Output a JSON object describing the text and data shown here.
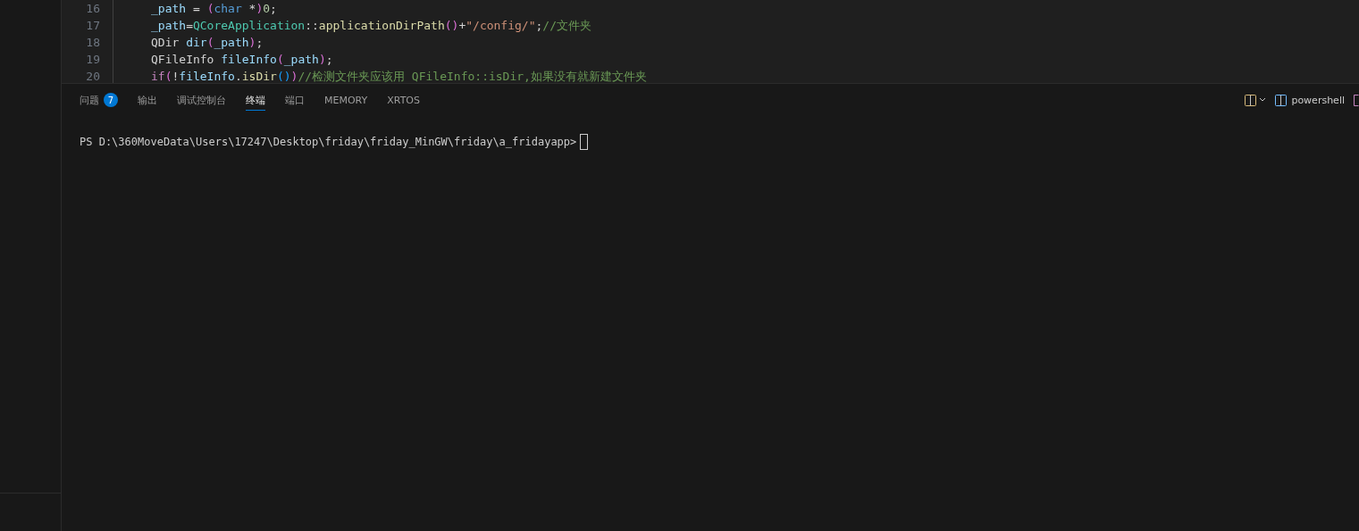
{
  "editor": {
    "lines": [
      {
        "number": "16",
        "tokens": [
          {
            "kind": "var",
            "text": "_path"
          },
          {
            "kind": "op",
            "text": " = "
          },
          {
            "kind": "paren",
            "text": "("
          },
          {
            "kind": "keyword",
            "text": "char"
          },
          {
            "kind": "op",
            "text": " *"
          },
          {
            "kind": "paren",
            "text": ")"
          },
          {
            "kind": "num",
            "text": "0"
          },
          {
            "kind": "op",
            "text": ";"
          }
        ]
      },
      {
        "number": "17",
        "tokens": [
          {
            "kind": "var",
            "text": "_path"
          },
          {
            "kind": "op",
            "text": "="
          },
          {
            "kind": "type",
            "text": "QCoreApplication"
          },
          {
            "kind": "op",
            "text": "::"
          },
          {
            "kind": "func",
            "text": "applicationDirPath"
          },
          {
            "kind": "paren",
            "text": "()"
          },
          {
            "kind": "op",
            "text": "+"
          },
          {
            "kind": "str",
            "text": "\"/config/\""
          },
          {
            "kind": "op",
            "text": ";"
          },
          {
            "kind": "comment",
            "text": "//文件夹"
          }
        ]
      },
      {
        "number": "18",
        "tokens": [
          {
            "kind": "plain",
            "text": "QDir "
          },
          {
            "kind": "var",
            "text": "dir"
          },
          {
            "kind": "paren",
            "text": "("
          },
          {
            "kind": "var",
            "text": "_path"
          },
          {
            "kind": "paren",
            "text": ")"
          },
          {
            "kind": "op",
            "text": ";"
          }
        ]
      },
      {
        "number": "19",
        "tokens": [
          {
            "kind": "plain",
            "text": "QFileInfo "
          },
          {
            "kind": "var",
            "text": "fileInfo"
          },
          {
            "kind": "paren",
            "text": "("
          },
          {
            "kind": "var",
            "text": "_path"
          },
          {
            "kind": "paren",
            "text": ")"
          },
          {
            "kind": "op",
            "text": ";"
          }
        ]
      },
      {
        "number": "20",
        "tokens": [
          {
            "kind": "keyword2",
            "text": "if"
          },
          {
            "kind": "paren",
            "text": "("
          },
          {
            "kind": "op",
            "text": "!"
          },
          {
            "kind": "var",
            "text": "fileInfo"
          },
          {
            "kind": "op",
            "text": "."
          },
          {
            "kind": "func",
            "text": "isDir"
          },
          {
            "kind": "paren2",
            "text": "()"
          },
          {
            "kind": "paren",
            "text": ")"
          },
          {
            "kind": "comment",
            "text": "//检测文件夹应该用 QFileInfo::isDir,如果没有就新建文件夹"
          }
        ]
      }
    ]
  },
  "panel": {
    "tabs": [
      {
        "label": "问题",
        "badge": "7",
        "selected": false
      },
      {
        "label": "输出",
        "selected": false
      },
      {
        "label": "调试控制台",
        "selected": false
      },
      {
        "label": "终端",
        "selected": true
      },
      {
        "label": "端口",
        "selected": false
      },
      {
        "label": "MEMORY",
        "selected": false
      },
      {
        "label": "XRTOS",
        "selected": false
      }
    ],
    "terminal_name": "powershell",
    "terminal": {
      "prompt": "PS D:\\360MoveData\\Users\\17247\\Desktop\\friday\\friday_MinGW\\friday\\a_fridayapp>"
    }
  }
}
